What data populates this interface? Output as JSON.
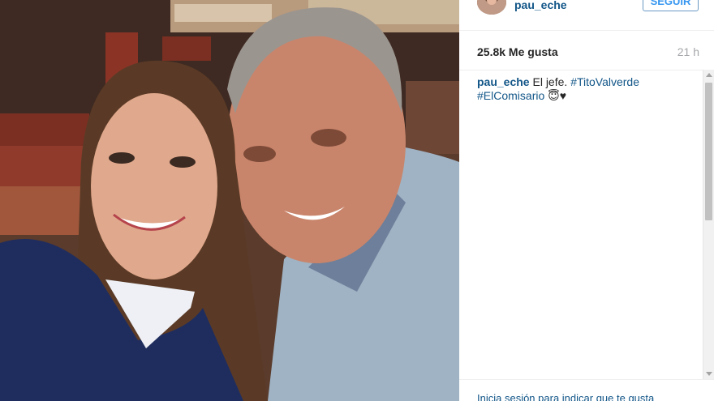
{
  "post": {
    "username": "pau_eche",
    "follow_label": "SEGUIR",
    "likes": "25.8k Me gusta",
    "time_ago": "21 h",
    "caption": {
      "user": "pau_eche",
      "text": " El jefe. ",
      "tag1": "#TitoValverde",
      "tag2": "#ElComisario",
      "emoji": " 😇♥"
    },
    "footer_hint": "Inicia sesión para indicar que te gusta"
  },
  "colors": {
    "link": "#125688",
    "follow": "#3897f0",
    "muted": "#a5a7aa"
  }
}
